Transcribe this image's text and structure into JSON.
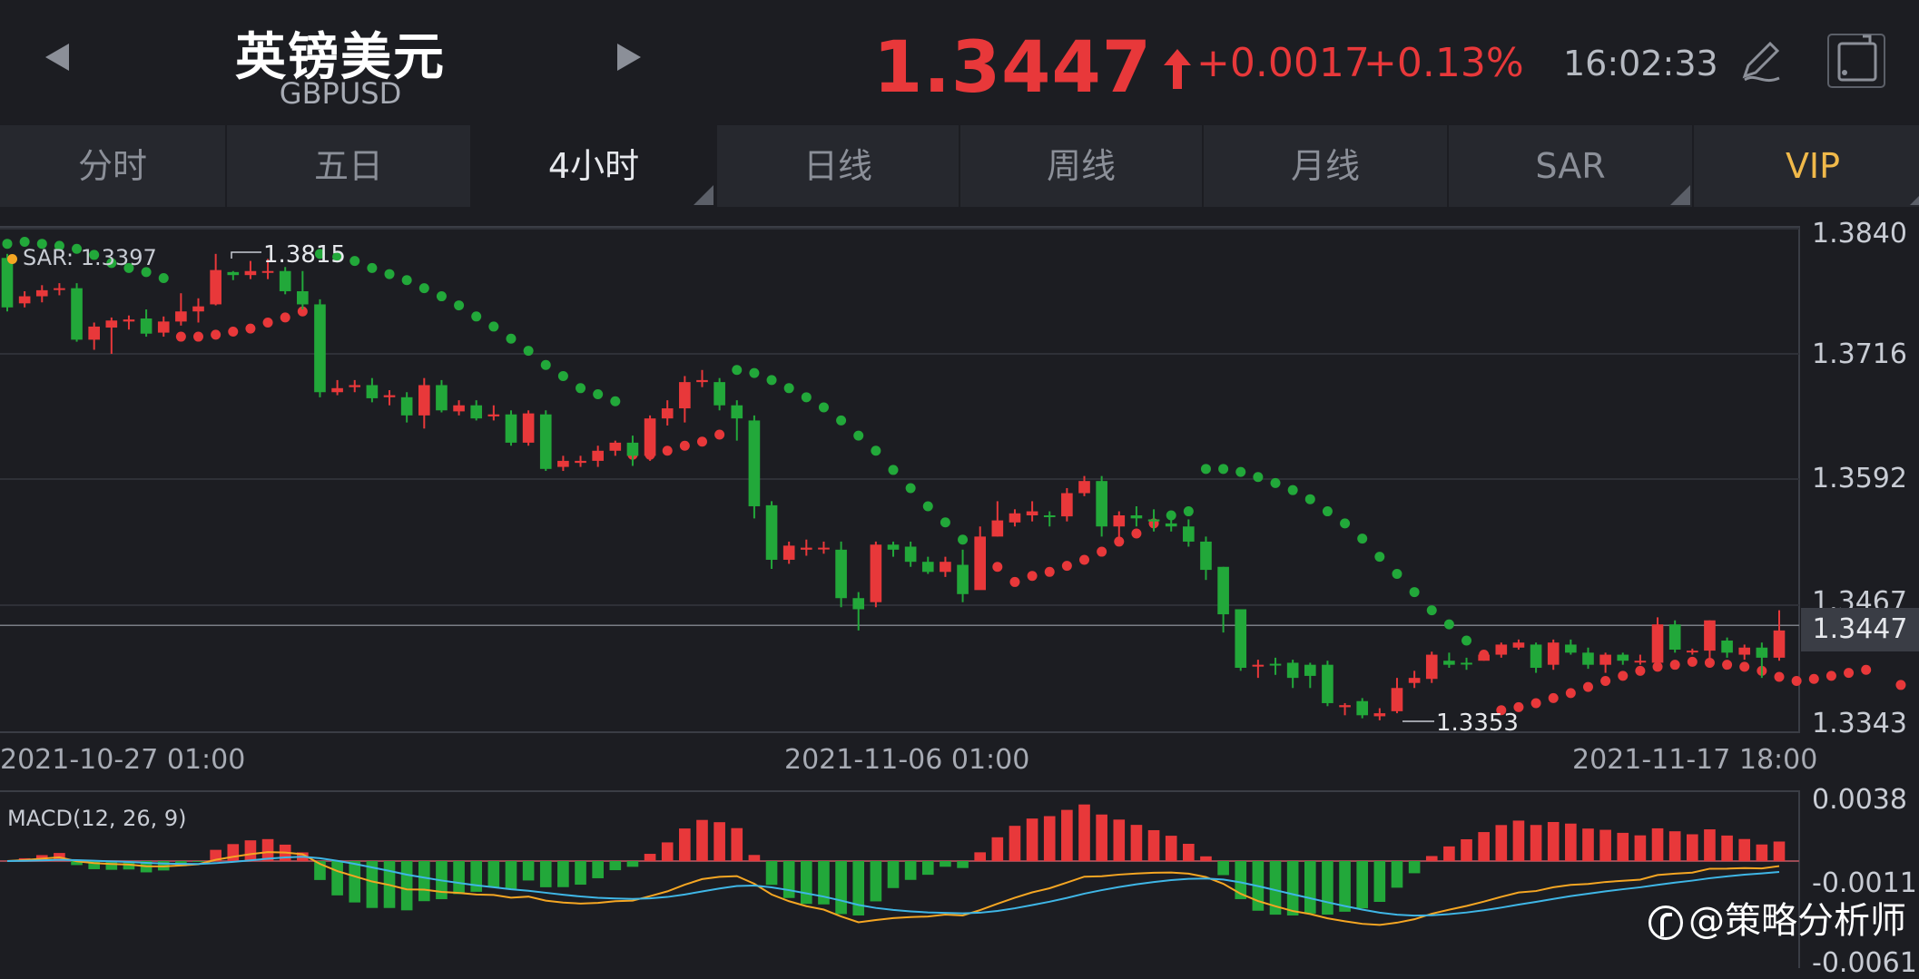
{
  "header": {
    "title_cn": "英镑美元",
    "symbol": "GBPUSD",
    "price": "1.3447",
    "change": "+0.0017",
    "change_pct": "+0.13%",
    "time": "16:02:33",
    "up_color": "#e8383a",
    "icons": [
      "chevron-left-icon",
      "chevron-right-icon",
      "up-arrow-icon",
      "pen-icon",
      "rotate-screen-icon"
    ]
  },
  "tabs": [
    {
      "label": "分时",
      "active": false
    },
    {
      "label": "五日",
      "active": false
    },
    {
      "label": "4小时",
      "active": true
    },
    {
      "label": "日线",
      "active": false
    },
    {
      "label": "周线",
      "active": false
    },
    {
      "label": "月线",
      "active": false
    },
    {
      "label": "SAR",
      "active": false
    },
    {
      "label": "VIP",
      "active": false
    }
  ],
  "chart": {
    "sar_label": "SAR: 1.3397",
    "high_label": "1.3815",
    "low_label": "1.3353",
    "current_label": "1.3447",
    "y_ticks": [
      "1.3840",
      "1.3716",
      "1.3592",
      "1.3467",
      "1.3343"
    ],
    "x_ticks": [
      "2021-10-27 01:00",
      "2021-11-06 01:00",
      "2021-11-17 18:00"
    ],
    "macd_label": "MACD(12, 26, 9)",
    "macd_y_ticks": [
      "0.0038",
      "-0.0011",
      "-0.0061"
    ]
  },
  "watermark": "@策略分析师",
  "chart_data": {
    "type": "candlestick",
    "indicator": "Parabolic SAR",
    "ylim": [
      1.3343,
      1.384
    ],
    "up_color": "#e8383a",
    "down_color": "#22a83a",
    "candles": [
      [
        1.3811,
        1.3762,
        1.3815,
        1.3758
      ],
      [
        1.3766,
        1.3773,
        1.3778,
        1.3762
      ],
      [
        1.3773,
        1.3779,
        1.3784,
        1.3767
      ],
      [
        1.378,
        1.3781,
        1.3786,
        1.3774
      ],
      [
        1.3781,
        1.373,
        1.3786,
        1.3728
      ],
      [
        1.373,
        1.3743,
        1.3747,
        1.372
      ],
      [
        1.3742,
        1.3749,
        1.3752,
        1.3716
      ],
      [
        1.3748,
        1.375,
        1.3754,
        1.374
      ],
      [
        1.3751,
        1.3736,
        1.376,
        1.3733
      ],
      [
        1.3737,
        1.3748,
        1.3753,
        1.3733
      ],
      [
        1.3748,
        1.3758,
        1.3776,
        1.3744
      ],
      [
        1.3758,
        1.3763,
        1.3771,
        1.3747
      ],
      [
        1.3765,
        1.3799,
        1.3815,
        1.3764
      ],
      [
        1.3797,
        1.3794,
        1.3798,
        1.3789
      ],
      [
        1.3794,
        1.3798,
        1.3808,
        1.379
      ],
      [
        1.3798,
        1.3798,
        1.381,
        1.379
      ],
      [
        1.3798,
        1.3778,
        1.3802,
        1.3775
      ],
      [
        1.3778,
        1.3765,
        1.3798,
        1.376
      ],
      [
        1.3765,
        1.3678,
        1.377,
        1.3673
      ],
      [
        1.3678,
        1.3682,
        1.369,
        1.3675
      ],
      [
        1.3683,
        1.3685,
        1.369,
        1.3678
      ],
      [
        1.3685,
        1.3672,
        1.3692,
        1.3668
      ],
      [
        1.3673,
        1.3675,
        1.368,
        1.3665
      ],
      [
        1.3673,
        1.3655,
        1.3678,
        1.3648
      ],
      [
        1.3655,
        1.3685,
        1.3692,
        1.3642
      ],
      [
        1.3685,
        1.366,
        1.369,
        1.3658
      ],
      [
        1.3659,
        1.3665,
        1.367,
        1.3655
      ],
      [
        1.3665,
        1.3652,
        1.367,
        1.365
      ],
      [
        1.3654,
        1.3656,
        1.3665,
        1.365
      ],
      [
        1.3656,
        1.3628,
        1.366,
        1.3625
      ],
      [
        1.3628,
        1.3657,
        1.366,
        1.3625
      ],
      [
        1.3656,
        1.3602,
        1.366,
        1.36
      ],
      [
        1.3604,
        1.361,
        1.3615,
        1.36
      ],
      [
        1.3608,
        1.361,
        1.3615,
        1.3604
      ],
      [
        1.361,
        1.362,
        1.3625,
        1.3604
      ],
      [
        1.362,
        1.3628,
        1.363,
        1.3615
      ],
      [
        1.3628,
        1.3615,
        1.3635,
        1.3605
      ],
      [
        1.3615,
        1.3652,
        1.3655,
        1.361
      ],
      [
        1.3652,
        1.3662,
        1.367,
        1.3645
      ],
      [
        1.3662,
        1.3688,
        1.3694,
        1.3648
      ],
      [
        1.3688,
        1.369,
        1.37,
        1.3683
      ],
      [
        1.3688,
        1.3665,
        1.3692,
        1.366
      ],
      [
        1.3665,
        1.3652,
        1.367,
        1.363
      ],
      [
        1.365,
        1.3565,
        1.3655,
        1.3553
      ],
      [
        1.3566,
        1.3512,
        1.357,
        1.3503
      ],
      [
        1.3512,
        1.3526,
        1.353,
        1.3508
      ],
      [
        1.3522,
        1.3524,
        1.3532,
        1.3516
      ],
      [
        1.3524,
        1.3524,
        1.353,
        1.3518
      ],
      [
        1.3522,
        1.3474,
        1.353,
        1.3465
      ],
      [
        1.3474,
        1.3463,
        1.348,
        1.3442
      ],
      [
        1.347,
        1.3527,
        1.353,
        1.3465
      ],
      [
        1.3527,
        1.3522,
        1.353,
        1.3515
      ],
      [
        1.3525,
        1.351,
        1.353,
        1.3505
      ],
      [
        1.351,
        1.35,
        1.3515,
        1.3498
      ],
      [
        1.35,
        1.351,
        1.3515,
        1.3495
      ],
      [
        1.3507,
        1.3478,
        1.3522,
        1.347
      ],
      [
        1.3482,
        1.3535,
        1.3545,
        1.3485
      ],
      [
        1.3535,
        1.3551,
        1.357,
        1.3535
      ],
      [
        1.3549,
        1.3558,
        1.3562,
        1.3545
      ],
      [
        1.3556,
        1.356,
        1.357,
        1.355
      ],
      [
        1.3556,
        1.3555,
        1.356,
        1.3545
      ],
      [
        1.3555,
        1.3578,
        1.3583,
        1.355
      ],
      [
        1.3578,
        1.359,
        1.3595,
        1.3575
      ],
      [
        1.359,
        1.3545,
        1.3595,
        1.3535
      ],
      [
        1.3545,
        1.3556,
        1.356,
        1.353
      ],
      [
        1.3556,
        1.3553,
        1.3565,
        1.3545
      ],
      [
        1.3552,
        1.355,
        1.3562,
        1.354
      ],
      [
        1.3548,
        1.3545,
        1.3552,
        1.354
      ],
      [
        1.3545,
        1.353,
        1.3552,
        1.3525
      ],
      [
        1.353,
        1.3502,
        1.3535,
        1.3492
      ],
      [
        1.3505,
        1.3458,
        1.3505,
        1.344
      ],
      [
        1.3463,
        1.3405,
        1.3463,
        1.3402
      ],
      [
        1.3407,
        1.3408,
        1.3413,
        1.3395
      ],
      [
        1.3409,
        1.3408,
        1.3415,
        1.3398
      ],
      [
        1.341,
        1.3395,
        1.3413,
        1.3385
      ],
      [
        1.3408,
        1.3397,
        1.341,
        1.3385
      ],
      [
        1.3408,
        1.337,
        1.3412,
        1.3367
      ],
      [
        1.3366,
        1.3368,
        1.337,
        1.3358
      ],
      [
        1.3372,
        1.3358,
        1.3375,
        1.3355
      ],
      [
        1.3357,
        1.336,
        1.3365,
        1.3353
      ],
      [
        1.3362,
        1.3385,
        1.3395,
        1.336
      ],
      [
        1.339,
        1.3395,
        1.3402,
        1.3385
      ],
      [
        1.3394,
        1.3418,
        1.3421,
        1.339
      ],
      [
        1.3412,
        1.3408,
        1.342,
        1.3405
      ],
      [
        1.341,
        1.3409,
        1.3415,
        1.3403
      ],
      [
        1.3412,
        1.3418,
        1.342,
        1.3412
      ],
      [
        1.3418,
        1.3428,
        1.343,
        1.3415
      ],
      [
        1.3425,
        1.343,
        1.3433,
        1.3423
      ],
      [
        1.3428,
        1.3405,
        1.343,
        1.34
      ],
      [
        1.3408,
        1.343,
        1.3433,
        1.3403
      ],
      [
        1.3428,
        1.342,
        1.3433,
        1.3418
      ],
      [
        1.342,
        1.3408,
        1.3425,
        1.3404
      ],
      [
        1.3408,
        1.3418,
        1.342,
        1.34
      ],
      [
        1.3418,
        1.3412,
        1.342,
        1.3408
      ],
      [
        1.3412,
        1.3412,
        1.3418,
        1.3408
      ],
      [
        1.341,
        1.3448,
        1.3455,
        1.3405
      ],
      [
        1.3448,
        1.3423,
        1.3452,
        1.342
      ],
      [
        1.3422,
        1.3422,
        1.3424,
        1.3418
      ],
      [
        1.3422,
        1.3452,
        1.3452,
        1.3405
      ],
      [
        1.3432,
        1.342,
        1.3435,
        1.3415
      ],
      [
        1.3418,
        1.3425,
        1.3428,
        1.3413
      ],
      [
        1.3425,
        1.3415,
        1.343,
        1.3395
      ],
      [
        1.3415,
        1.3442,
        1.3462,
        1.3412
      ]
    ],
    "sar": [
      1.3825,
      1.3827,
      1.3825,
      1.3823,
      1.382,
      1.3814,
      1.3806,
      1.3801,
      1.3797,
      1.3791,
      1.3733,
      1.3733,
      1.3735,
      1.3738,
      1.3741,
      1.3747,
      1.3752,
      1.3758,
      1.3815,
      1.3812,
      1.3808,
      1.3801,
      1.3795,
      1.3789,
      1.3781,
      1.3773,
      1.3764,
      1.3753,
      1.3743,
      1.3731,
      1.3719,
      1.3705,
      1.3694,
      1.3682,
      1.3676,
      1.3669,
      1.3616,
      1.3616,
      1.362,
      1.3625,
      1.3629,
      1.3636,
      1.37,
      1.3697,
      1.369,
      1.3682,
      1.3673,
      1.3663,
      1.365,
      1.3635,
      1.362,
      1.3601,
      1.3583,
      1.3565,
      1.3549,
      1.3532,
      1.3518,
      1.3505,
      1.349,
      1.3496,
      1.35,
      1.3506,
      1.3512,
      1.352,
      1.353,
      1.3538,
      1.3548,
      1.3556,
      1.356,
      1.3602,
      1.3602,
      1.3599,
      1.3594,
      1.3588,
      1.3581,
      1.3572,
      1.356,
      1.3548,
      1.3533,
      1.3515,
      1.3498,
      1.348,
      1.3462,
      1.3448,
      1.3432,
      1.3418,
      1.3363,
      1.3366,
      1.337,
      1.3375,
      1.338,
      1.3386,
      1.3392,
      1.3397,
      1.3402,
      1.3406,
      1.3408,
      1.3411,
      1.341,
      1.3408,
      1.3406,
      1.3402,
      1.3396,
      1.3392,
      1.3394,
      1.3397,
      1.34,
      1.3403,
      1.3452,
      1.3388
    ]
  }
}
